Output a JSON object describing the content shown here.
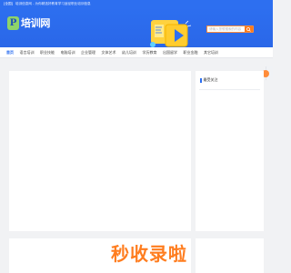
{
  "topbar": {
    "city": "[全国]",
    "notice": "培训信息网 - 为你精选好教育学习途径职业培训信息"
  },
  "header": {
    "logo_badge": "P",
    "logo_text": "培训网",
    "search_placeholder": "请输入您想搜索的内容"
  },
  "nav": {
    "items": [
      {
        "label": "首页",
        "active": true
      },
      {
        "label": "语言培训"
      },
      {
        "label": "职业技能"
      },
      {
        "label": "电脑培训"
      },
      {
        "label": "企业管理"
      },
      {
        "label": "文体艺术"
      },
      {
        "label": "幼儿培训"
      },
      {
        "label": "学历教育"
      },
      {
        "label": "出国留学"
      },
      {
        "label": "职业金融"
      },
      {
        "label": "其它培训"
      }
    ]
  },
  "sidebar": {
    "title": "最受关注"
  },
  "watermark": "秒收录啦",
  "colors": {
    "brand": "#2d6ff0",
    "accent": "#ff7d1f",
    "logo_badge": "#8ed36a"
  }
}
